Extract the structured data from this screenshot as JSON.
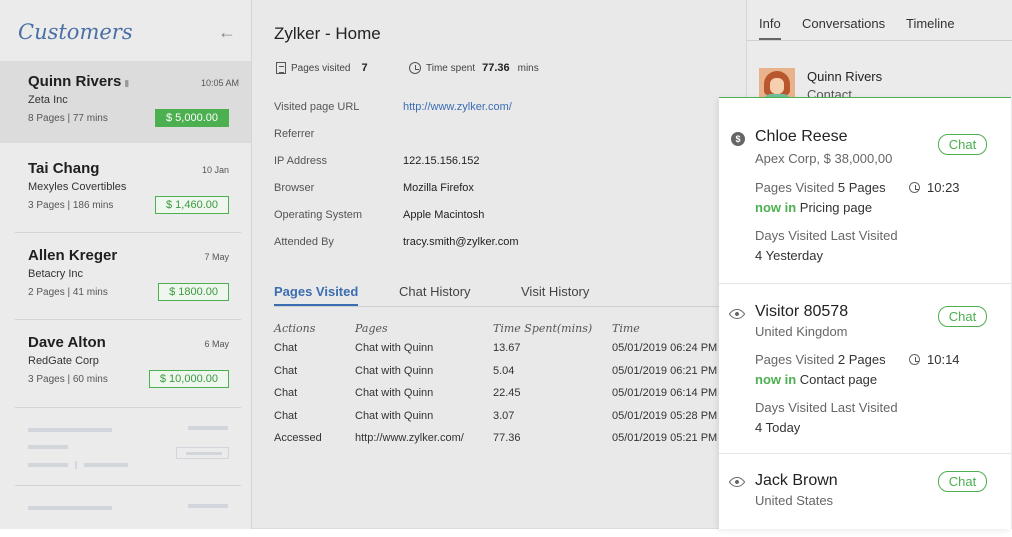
{
  "sidebar": {
    "title": "Customers",
    "back_icon": "left-arrow-icon",
    "customers": [
      {
        "name": "Quinn Rivers",
        "time": "10:05 AM",
        "company": "Zeta Inc",
        "meta": "8 Pages | 77 mins",
        "amount": "$ 5,000.00"
      },
      {
        "name": "Tai Chang",
        "time": "10 Jan",
        "company": "Mexyles Covertibles",
        "meta": "3 Pages | 186 mins",
        "amount": "$ 1,460.00"
      },
      {
        "name": "Allen Kreger",
        "time": "7 May",
        "company": "Betacry Inc",
        "meta": "2 Pages | 41 mins",
        "amount": "$ 1800.00"
      },
      {
        "name": "Dave Alton",
        "time": "6 May",
        "company": "RedGate Corp",
        "meta": "3 Pages | 60 mins",
        "amount": "$ 10,000.00"
      }
    ]
  },
  "main": {
    "title": "Zylker - Home",
    "pages_visited_label": "Pages visited",
    "pages_visited_value": "7",
    "time_spent_label": "Time spent",
    "time_spent_value": "77.36",
    "time_spent_unit": "mins",
    "info": [
      {
        "label": "Visited page URL",
        "value": "http://www.zylker.com/"
      },
      {
        "label": "Referrer",
        "value": ""
      },
      {
        "label": "IP Address",
        "value": "122.15.156.152"
      },
      {
        "label": "Browser",
        "value": "Mozilla Firefox"
      },
      {
        "label": "Operating System",
        "value": "Apple Macintosh"
      },
      {
        "label": "Attended By",
        "value": "tracy.smith@zylker.com"
      }
    ],
    "tabs": [
      "Pages Visited",
      "Chat History",
      "Visit History"
    ],
    "table": {
      "headers": [
        "Actions",
        "Pages",
        "Time Spent(mins)",
        "Time"
      ],
      "rows": [
        [
          "Chat",
          "Chat with Quinn",
          "13.67",
          "05/01/2019 06:24 PM"
        ],
        [
          "Chat",
          "Chat with Quinn",
          "5.04",
          "05/01/2019 06:21 PM"
        ],
        [
          "Chat",
          "Chat with Quinn",
          "22.45",
          "05/01/2019 06:14 PM"
        ],
        [
          "Chat",
          "Chat with Quinn",
          "3.07",
          "05/01/2019 05:28 PM"
        ],
        [
          "Accessed",
          "http://www.zylker.com/",
          "77.36",
          "05/01/2019 05:21 PM"
        ]
      ]
    }
  },
  "right_panel": {
    "tabs": [
      "Info",
      "Conversations",
      "Timeline"
    ],
    "contact_name": "Quinn Rivers",
    "contact_role": "Contact"
  },
  "visitors": [
    {
      "icon": "dollar-icon",
      "name": "Chloe Reese",
      "sub": "Apex Corp, $ 38,000,00",
      "pages_label": "Pages Visited",
      "pages": "5 Pages",
      "time": "10:23",
      "now_in": "now in",
      "page": "Pricing page",
      "days_label": "Days Visited Last Visited",
      "days": "4 Yesterday",
      "chat_label": "Chat"
    },
    {
      "icon": "eye-icon",
      "name": "Visitor 80578",
      "sub": "United Kingdom",
      "pages_label": "Pages Visited",
      "pages": "2 Pages",
      "time": "10:14",
      "now_in": "now in",
      "page": "Contact page",
      "days_label": "Days Visited Last Visited",
      "days": "4 Today",
      "chat_label": "Chat"
    },
    {
      "icon": "eye-icon",
      "name": "Jack Brown",
      "sub": "United States",
      "chat_label": "Chat"
    }
  ]
}
